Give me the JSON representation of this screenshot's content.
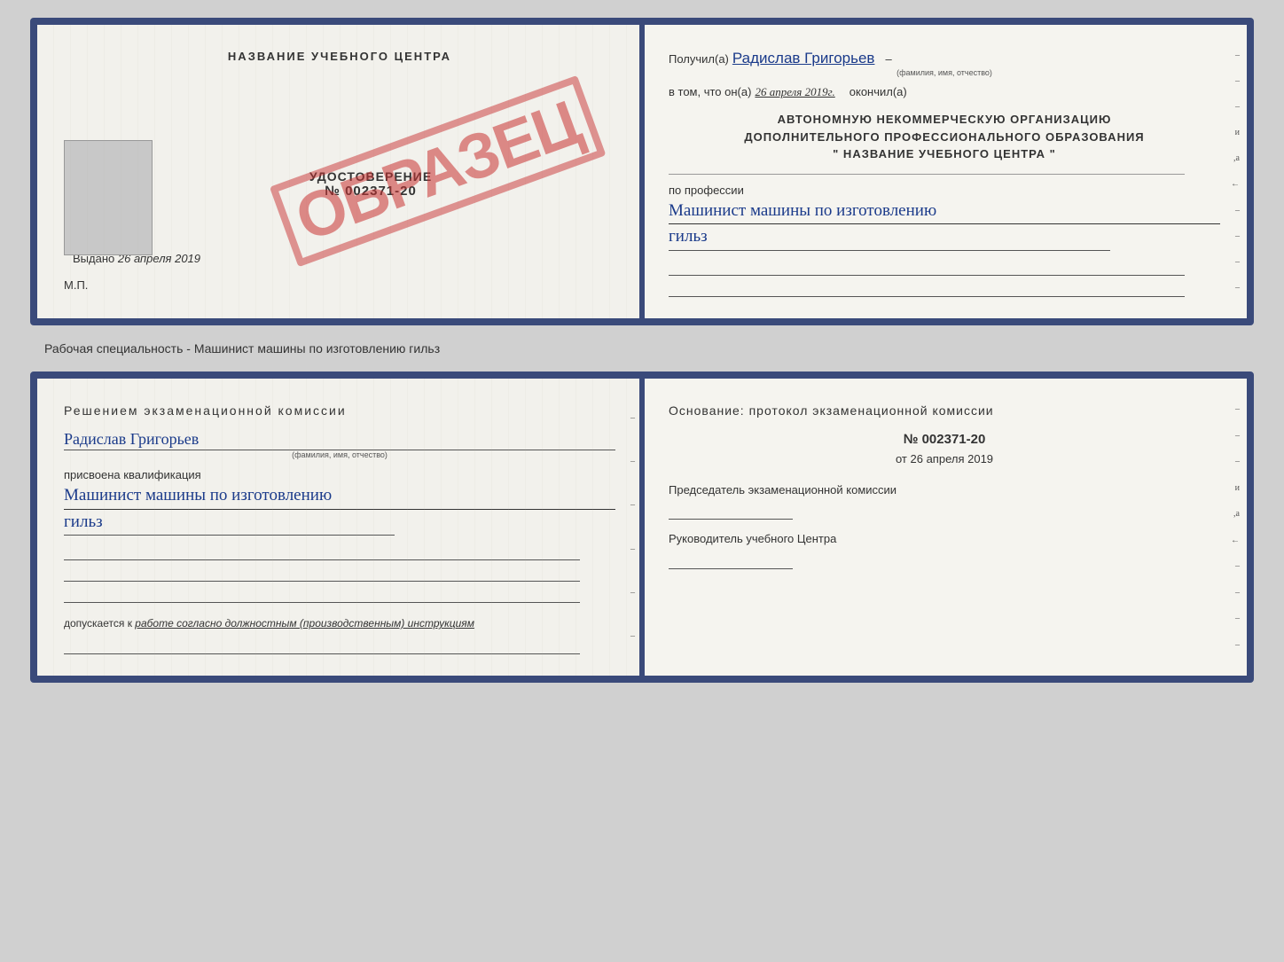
{
  "top_doc": {
    "left": {
      "title": "НАЗВАНИЕ УЧЕБНОГО ЦЕНТРА",
      "udost_word": "УДОСТОВЕРЕНИЕ",
      "udost_number": "№ 002371-20",
      "vydano": "Выдано",
      "vydano_date": "26 апреля 2019",
      "mp": "М.П.",
      "obrazec": "ОБРАЗЕЦ"
    },
    "right": {
      "poluchil_label": "Получил(а)",
      "poluchil_name": "Радислав Григорьев",
      "poluchil_subtitle": "(фамилия, имя, отчество)",
      "vtom_label": "в том, что он(а)",
      "date_value": "26 апреля 2019г.",
      "okonchil": "окончил(а)",
      "org_line1": "АВТОНОМНУЮ НЕКОММЕРЧЕСКУЮ ОРГАНИЗАЦИЮ",
      "org_line2": "ДОПОЛНИТЕЛЬНОГО ПРОФЕССИОНАЛЬНОГО ОБРАЗОВАНИЯ",
      "org_line3": "\" НАЗВАНИЕ УЧЕБНОГО ЦЕНТРА \"",
      "po_professii": "по профессии",
      "profession_line1": "Машинист машины по изготовлению",
      "profession_line2": "гильз"
    }
  },
  "separator": {
    "label": "Рабочая специальность - Машинист машины по изготовлению гильз"
  },
  "bottom_doc": {
    "left": {
      "resheniem": "Решением  экзаменационной  комиссии",
      "name": "Радислав Григорьев",
      "name_subtitle": "(фамилия, имя, отчество)",
      "prisvoena": "присвоена квалификация",
      "kvalif_line1": "Машинист  машины  по изготовлению",
      "kvalif_line2": "гильз",
      "dopuskaetsya": "допускается к",
      "dopusk_text": "работе согласно должностным (производственным) инструкциям"
    },
    "right": {
      "osnovanie": "Основание: протокол экзаменационной  комиссии",
      "number": "№  002371-20",
      "ot_label": "от",
      "ot_date": "26 апреля 2019",
      "predsedatel_label": "Председатель экзаменационной комиссии",
      "rukovoditel_label": "Руководитель учебного Центра"
    }
  },
  "side_marks": {
    "items": [
      "–",
      "–",
      "–",
      "и",
      "а",
      "←",
      "–",
      "–",
      "–",
      "–"
    ]
  }
}
